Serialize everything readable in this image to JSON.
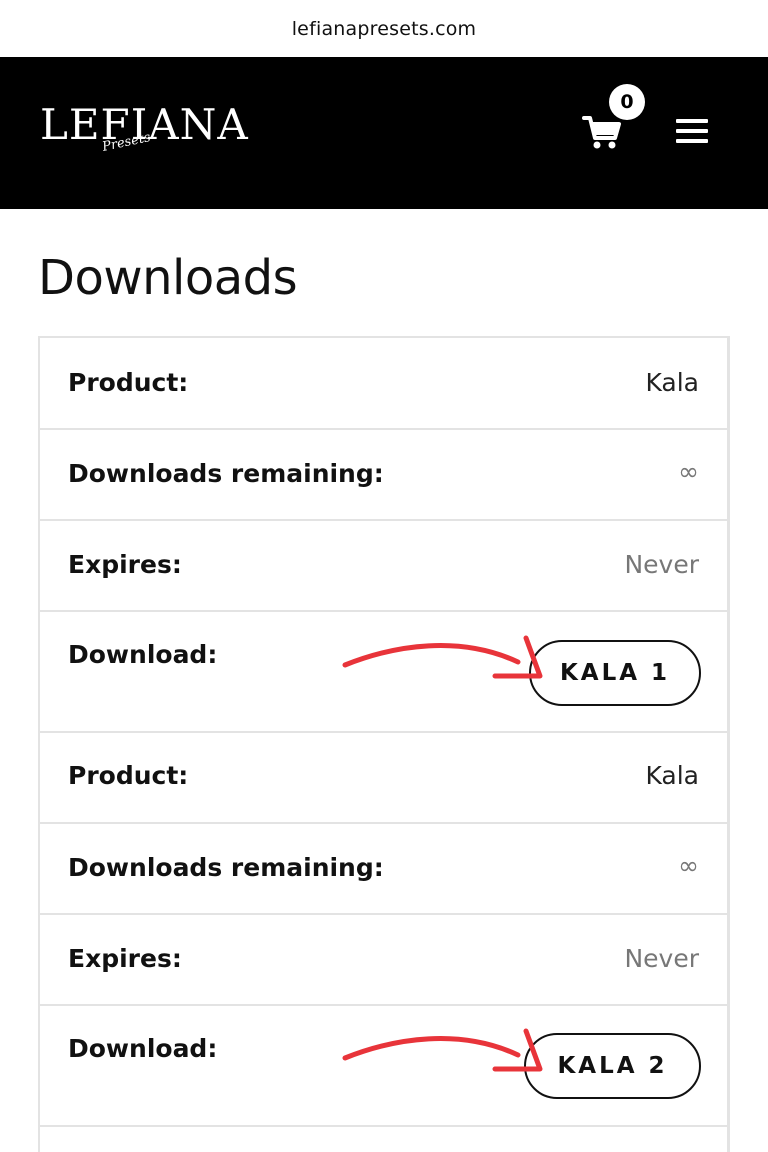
{
  "browser": {
    "url": "lefianapresets.com"
  },
  "header": {
    "logo_text": "LEFIANA",
    "logo_script": "Presets",
    "cart_count": "0"
  },
  "page": {
    "title": "Downloads"
  },
  "downloads": [
    {
      "product_label": "Product:",
      "product_value": "Kala",
      "remaining_label": "Downloads remaining:",
      "remaining_value": "∞",
      "expires_label": "Expires:",
      "expires_value": "Never",
      "download_label": "Download:",
      "button_label": "KALA 1"
    },
    {
      "product_label": "Product:",
      "product_value": "Kala",
      "remaining_label": "Downloads remaining:",
      "remaining_value": "∞",
      "expires_label": "Expires:",
      "expires_value": "Never",
      "download_label": "Download:",
      "button_label": "KALA 2"
    }
  ],
  "colors": {
    "header_bg": "#000000",
    "arrow": "#e8343a",
    "border": "#e3e3e3"
  }
}
